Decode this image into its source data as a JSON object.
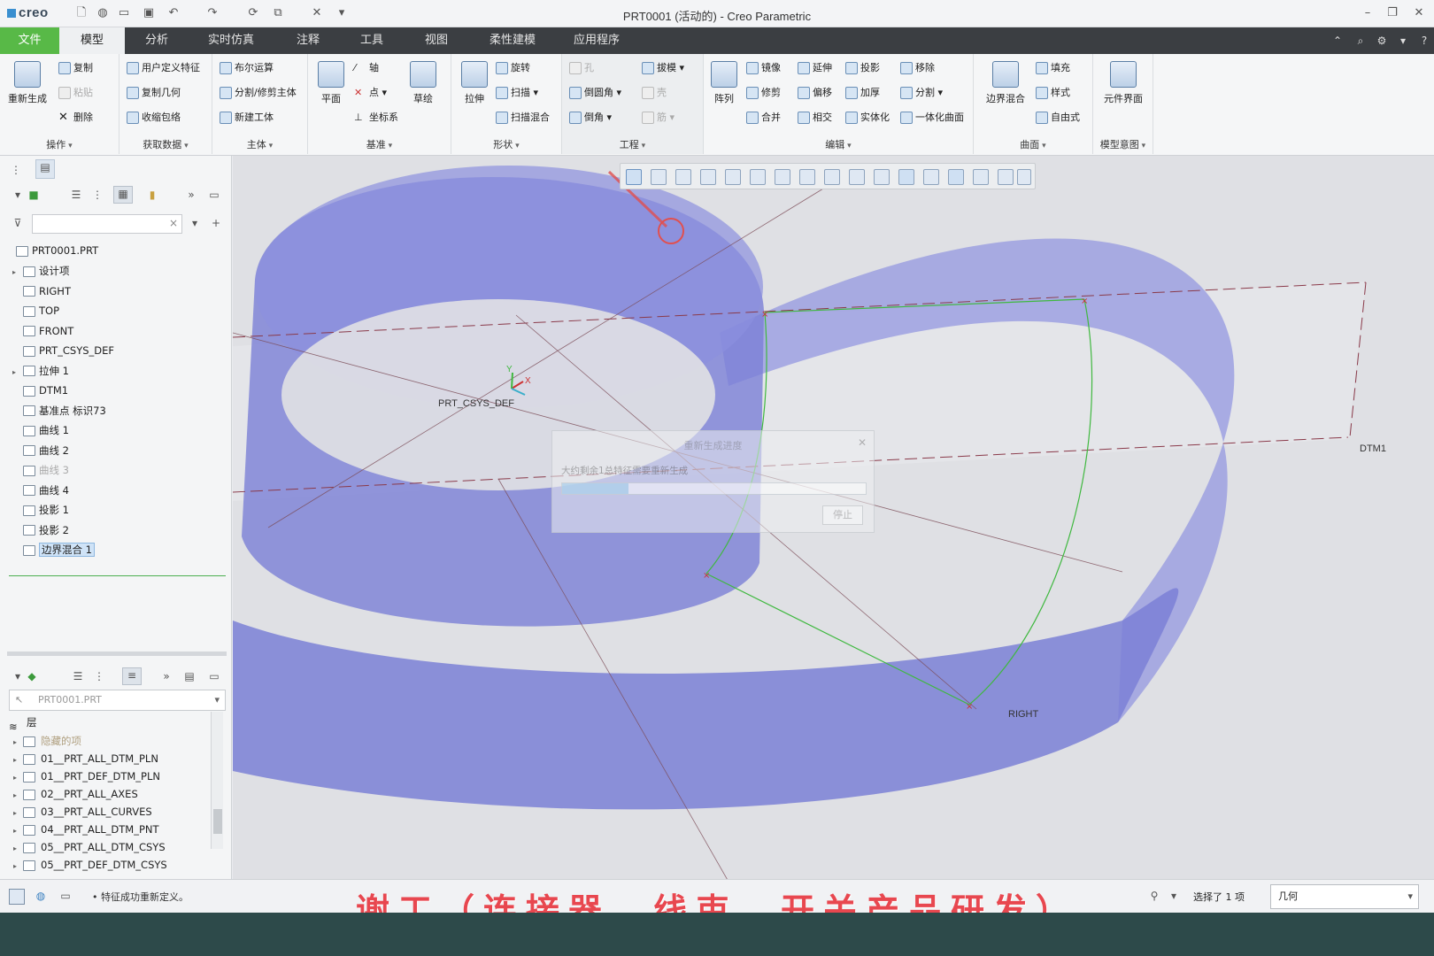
{
  "app": {
    "logo": "creo",
    "window_title": "PRT0001 (活动的) - Creo Parametric"
  },
  "menu": {
    "tabs": [
      "文件",
      "模型",
      "分析",
      "实时仿真",
      "注释",
      "工具",
      "视图",
      "柔性建模",
      "应用程序"
    ],
    "active": "模型"
  },
  "ribbon": {
    "operations": {
      "label": "操作",
      "regen": "重新生成",
      "copy": "复制",
      "paste": "粘贴",
      "delete": "删除"
    },
    "get_data": {
      "label": "获取数据",
      "udf": "用户定义特征",
      "copy_geom": "复制几何",
      "shrinkwrap": "收缩包络"
    },
    "body": {
      "label": "主体",
      "boolean": "布尔运算",
      "split": "分割/修剪主体",
      "new_body": "新建工体"
    },
    "datum": {
      "label": "基准",
      "plane": "平面",
      "axis": "轴",
      "point": "点",
      "csys": "坐标系",
      "sketch": "草绘"
    },
    "shapes": {
      "label": "形状",
      "extrude": "拉伸",
      "revolve": "旋转",
      "sweep": "扫描",
      "swept_blend": "扫描混合"
    },
    "engineering": {
      "label": "工程",
      "hole": "孔",
      "draft": "拔模",
      "round": "倒圆角",
      "shell": "壳",
      "chamfer": "倒角",
      "rib": "筋"
    },
    "editing": {
      "label": "编辑",
      "pattern": "阵列",
      "mirror": "镜像",
      "extend": "延伸",
      "project": "投影",
      "trim": "修剪",
      "offset": "偏移",
      "thicken": "加厚",
      "merge": "合并",
      "intersect": "相交",
      "solidify": "实体化",
      "remove": "移除",
      "split": "分割",
      "unify": "一体化曲面"
    },
    "surfaces": {
      "label": "曲面",
      "boundary_blend": "边界混合",
      "fill": "填充",
      "style": "样式",
      "freestyle": "自由式"
    },
    "model_intent": {
      "label": "模型意图",
      "component_interface": "元件界面"
    }
  },
  "model_tree": {
    "root": "PRT0001.PRT",
    "items": [
      {
        "label": "设计项",
        "icon": "design-items-icon",
        "expand": true,
        "dim": false
      },
      {
        "label": "RIGHT",
        "icon": "datum-plane-icon",
        "expand": false,
        "dim": false
      },
      {
        "label": "TOP",
        "icon": "datum-plane-icon",
        "expand": false,
        "dim": false
      },
      {
        "label": "FRONT",
        "icon": "datum-plane-icon",
        "expand": false,
        "dim": false
      },
      {
        "label": "PRT_CSYS_DEF",
        "icon": "csys-icon",
        "expand": false,
        "dim": false
      },
      {
        "label": "拉伸 1",
        "icon": "extrude-icon",
        "expand": true,
        "dim": false
      },
      {
        "label": "DTM1",
        "icon": "datum-plane-icon",
        "expand": false,
        "dim": false
      },
      {
        "label": "基准点 标识73",
        "icon": "datum-point-icon",
        "expand": false,
        "dim": false
      },
      {
        "label": "曲线 1",
        "icon": "curve-icon",
        "expand": false,
        "dim": false
      },
      {
        "label": "曲线 2",
        "icon": "curve-icon",
        "expand": false,
        "dim": false
      },
      {
        "label": "曲线 3",
        "icon": "curve-icon",
        "expand": false,
        "dim": true
      },
      {
        "label": "曲线 4",
        "icon": "curve-icon",
        "expand": false,
        "dim": false
      },
      {
        "label": "投影 1",
        "icon": "projection-icon",
        "expand": false,
        "dim": false
      },
      {
        "label": "投影 2",
        "icon": "projection-icon",
        "expand": false,
        "dim": false
      },
      {
        "label": "边界混合 1",
        "icon": "boundary-blend-icon",
        "expand": false,
        "dim": false,
        "selected": true
      }
    ]
  },
  "layer_tree": {
    "selector": "PRT0001.PRT",
    "header": "层",
    "items": [
      {
        "label": "隐藏的项",
        "dim": true
      },
      {
        "label": "01__PRT_ALL_DTM_PLN"
      },
      {
        "label": "01__PRT_DEF_DTM_PLN"
      },
      {
        "label": "02__PRT_ALL_AXES"
      },
      {
        "label": "03__PRT_ALL_CURVES"
      },
      {
        "label": "04__PRT_ALL_DTM_PNT"
      },
      {
        "label": "05__PRT_ALL_DTM_CSYS"
      },
      {
        "label": "05__PRT_DEF_DTM_CSYS"
      }
    ]
  },
  "viewport": {
    "labels": {
      "csys": "PRT_CSYS_DEF",
      "dtm1": "DTM1",
      "right": "RIGHT",
      "axis_x": "X",
      "axis_y": "Y"
    },
    "colors": {
      "surface": "#7b80d6",
      "datum": "#8a3a4a",
      "curve": "#3fb83f"
    }
  },
  "regen_dialog": {
    "title": "重新生成进度",
    "message": "大约剩余1总特征需要重新生成",
    "progress": 0.22,
    "stop": "停止"
  },
  "status": {
    "message": "• 特征成功重新定义。",
    "selection": "选择了 1 项",
    "filter": "几何"
  },
  "caption": "谢工（连接器、线束、开关产品研发）"
}
